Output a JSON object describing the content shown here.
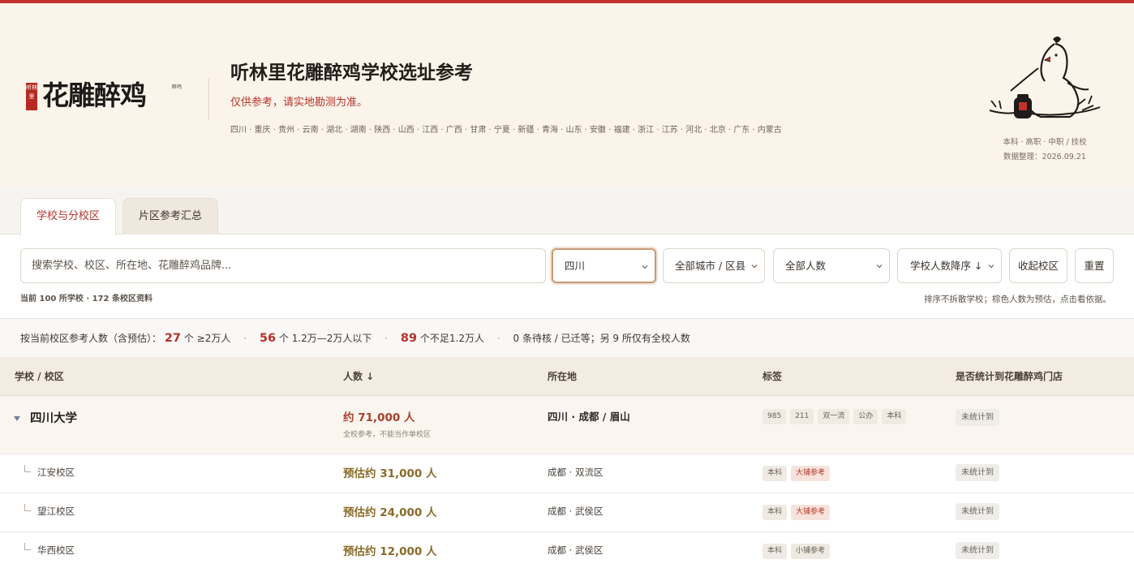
{
  "brand": {
    "seal_text": "听林里",
    "wordmark": "花雕醉鸡",
    "side_text": "醉鸡"
  },
  "hero": {
    "title": "听林里花雕醉鸡学校选址参考",
    "subtitle": "仅供参考，请实地勘测为准。",
    "provinces": "四川 · 重庆 · 贵州 · 云南 · 湖北 · 湖南 · 陕西 · 山西 · 江西 · 广西 · 甘肃 · 宁夏 · 新疆 · 青海 · 山东 · 安徽 · 福建 · 浙江 · 江苏 · 河北 · 北京 · 广东 · 内蒙古",
    "levels": "本科 · 高职 · 中职 / 技校",
    "updated_label": "数据整理：",
    "updated_date": "2026.09.21",
    "mascot_icon": "drunken-chicken-illustration-icon"
  },
  "tabs": [
    {
      "label": "学校与分校区",
      "active": true
    },
    {
      "label": "片区参考汇总",
      "active": false
    }
  ],
  "filters": {
    "search_placeholder": "搜索学校、校区、所在地、花雕醉鸡品牌...",
    "province": "四川",
    "city": "全部城市 / 区县",
    "headcount": "全部人数",
    "sort": "学校人数降序 ↓",
    "collapse_button": "收起校区",
    "reset_button": "重置",
    "stat_left": "当前 100 所学校 · 172 条校区资料",
    "stat_right": "排序不拆散学校；棕色人数为预估，点击看依据。"
  },
  "summary": {
    "prefix": "按当前校区参考人数（含预估）：",
    "n1": "27",
    "t1": "个 ≥2万人",
    "n2": "56",
    "t2": "个 1.2万—2万人以下",
    "n3": "89",
    "t3": "个不足1.2万人",
    "t4": "0 条待核 / 已迁等；另 9 所仅有全校人数",
    "separator": "·"
  },
  "table": {
    "headers": {
      "school": "学校 / 校区",
      "count": "人数 ↓",
      "location": "所在地",
      "tags": "标签",
      "counted": "是否统计到花雕醉鸡门店"
    },
    "university": {
      "name": "四川大学",
      "count": "约 71,000 人",
      "note": "全校参考，不能当作单校区",
      "location": "四川 · 成都 / 眉山",
      "tags": [
        "985",
        "211",
        "双一流",
        "公办",
        "本科"
      ],
      "counted": "未统计到"
    },
    "campuses": [
      {
        "name": "江安校区",
        "count": "预估约 31,000 人",
        "location": "成都 · 双流区",
        "tag1": "本科",
        "tag2": "大铺参考",
        "counted": "未统计到"
      },
      {
        "name": "望江校区",
        "count": "预估约 24,000 人",
        "location": "成都 · 武侯区",
        "tag1": "本科",
        "tag2": "大铺参考",
        "counted": "未统计到"
      },
      {
        "name": "华西校区",
        "count": "预估约 12,000 人",
        "location": "成都 · 武侯区",
        "tag1": "本科",
        "tag2": "小铺参考",
        "counted": "未统计到"
      }
    ]
  },
  "colors": {
    "accent": "#c0322b",
    "hero_bg": "#faf4ea",
    "estimate_brown": "#8a6a28"
  }
}
